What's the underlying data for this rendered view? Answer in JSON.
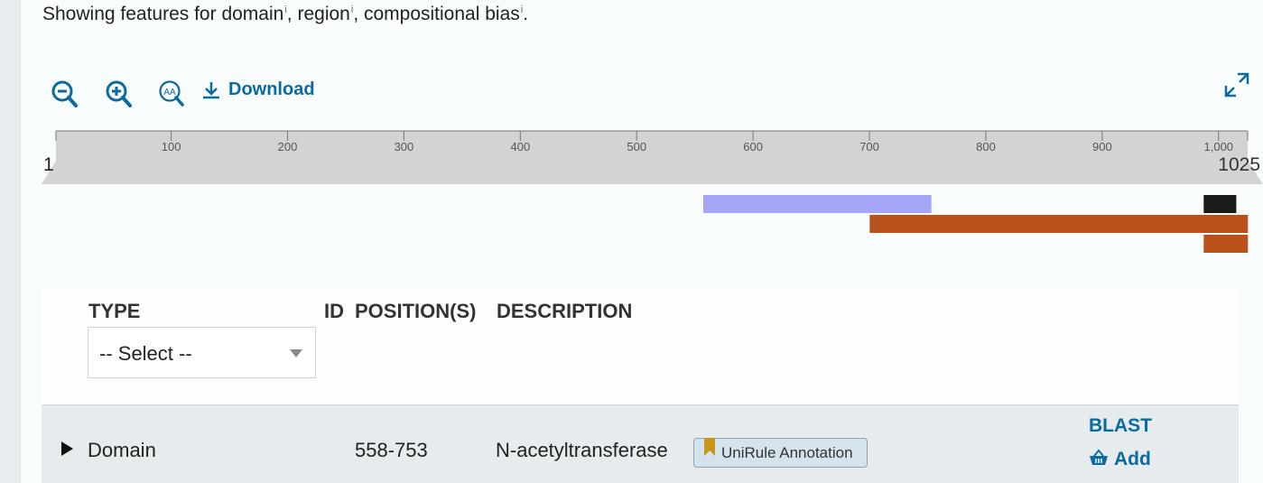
{
  "summary": {
    "prefix": "Showing features for ",
    "items": [
      {
        "label": "domain",
        "sep": ", "
      },
      {
        "label": "region",
        "sep": ", "
      },
      {
        "label": "compositional bias",
        "sep": "."
      }
    ],
    "info_glyph": "i"
  },
  "toolbar": {
    "tools": [
      {
        "name": "zoom-out-icon"
      },
      {
        "name": "zoom-in-icon"
      },
      {
        "name": "zoom-reset-icon",
        "text": "AA"
      }
    ],
    "download_label": "Download"
  },
  "ruler": {
    "start_label": "1",
    "end_label": "1025",
    "length": 1025,
    "ticks": [
      {
        "value": 100,
        "label": "100"
      },
      {
        "value": 200,
        "label": "200"
      },
      {
        "value": 300,
        "label": "300"
      },
      {
        "value": 400,
        "label": "400"
      },
      {
        "value": 500,
        "label": "500"
      },
      {
        "value": 600,
        "label": "600"
      },
      {
        "value": 700,
        "label": "700"
      },
      {
        "value": 800,
        "label": "800"
      },
      {
        "value": 900,
        "label": "900"
      },
      {
        "value": 1000,
        "label": "1,000"
      }
    ]
  },
  "features": [
    {
      "type": "domain",
      "start": 558,
      "end": 753,
      "color": "#a6a6f8"
    },
    {
      "type": "region",
      "start": 701,
      "end": 1025,
      "color": "#b9511b"
    },
    {
      "type": "region",
      "start": 988,
      "end": 1025,
      "color": "#b9511b"
    },
    {
      "type": "compositional-bias",
      "start": 988,
      "end": 1015,
      "color": "#1a1a1a"
    }
  ],
  "table": {
    "headers": {
      "type": "TYPE",
      "id": "ID",
      "positions": "POSITION(S)",
      "description": "DESCRIPTION"
    },
    "type_select": {
      "value": "-- Select --"
    },
    "rows": [
      {
        "type": "Domain",
        "position": "558-753",
        "description": "N-acetyltransferase",
        "badge": "UniRule Annotation",
        "actions": {
          "blast": "BLAST",
          "add": "Add"
        }
      }
    ]
  },
  "colors": {
    "accent": "#0b6a9f",
    "ruler_fill": "#d2d3d5",
    "row_bg": "#e6ebee"
  }
}
